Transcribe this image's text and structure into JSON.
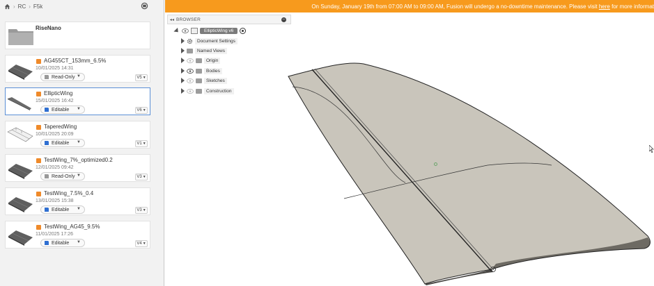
{
  "breadcrumb": [
    "RC",
    "F5k"
  ],
  "folder": {
    "name": "RiseNano"
  },
  "files": [
    {
      "name": "AG455CT_153mm_6.5%",
      "date": "10/01/2025 14:31",
      "status": "Read-Only",
      "version": "V5",
      "selected": false
    },
    {
      "name": "EllipticWing",
      "date": "15/01/2025 16:42",
      "status": "Editable",
      "version": "V6",
      "selected": true
    },
    {
      "name": "TaperedWing",
      "date": "10/01/2025 20:09",
      "status": "Editable",
      "version": "V1",
      "selected": false
    },
    {
      "name": "TestWing_7%_optimized0.2",
      "date": "12/01/2025 09:42",
      "status": "Read-Only",
      "version": "V3",
      "selected": false
    },
    {
      "name": "TestWing_7.5%_0.4",
      "date": "13/01/2025 15:38",
      "status": "Editable",
      "version": "V3",
      "selected": false
    },
    {
      "name": "TestWing_AG45_9.5%",
      "date": "11/01/2025 17:26",
      "status": "Editable",
      "version": "V4",
      "selected": false
    }
  ],
  "banner": {
    "text": "On Sunday, January 19th from 07:00 AM to 09:00 AM, Fusion will undergo a no-downtime maintenance. Please visit ",
    "link": "here",
    "suffix": " for more informat"
  },
  "browser": {
    "title": "BROWSER",
    "root": "EllipticWing v6",
    "items": [
      {
        "label": "Document Settings",
        "icon": "gear-icon",
        "eye": false
      },
      {
        "label": "Named Views",
        "icon": "folder-icon",
        "eye": false
      },
      {
        "label": "Origin",
        "icon": "folder-icon",
        "eye": true
      },
      {
        "label": "Bodies",
        "icon": "folder-icon",
        "eye": true
      },
      {
        "label": "Sketches",
        "icon": "folder-icon",
        "eye": true
      },
      {
        "label": "Construction",
        "icon": "folder-icon",
        "eye": false
      }
    ]
  },
  "colors": {
    "banner": "#f79a1d",
    "cube": "#ef8a2a",
    "wing": "#c9c5bb",
    "selected": "#5b8fd6"
  }
}
